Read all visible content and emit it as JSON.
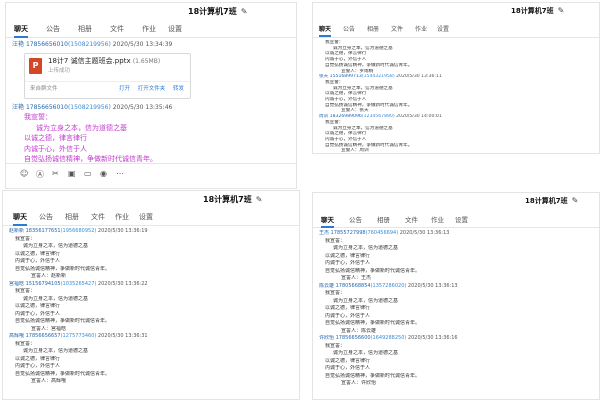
{
  "panel1": {
    "title": "18计算机7班",
    "tabs": [
      "聊天",
      "公告",
      "相册",
      "文件",
      "作业",
      "设置"
    ],
    "msg1_header": {
      "name": "汪艳",
      "id": "17856656010",
      "qq": "(1508219956)",
      "time": "2020/5/30 13:34:39"
    },
    "file": {
      "name": "18计7 诚信主题班会.pptx",
      "size": "(1.65MB)",
      "status": "上传成功",
      "source": "来自群文件",
      "actions": [
        "打开",
        "打开文件夹",
        "转发"
      ]
    },
    "msg2_header": {
      "name": "汪艳",
      "id": "17856656010",
      "qq": "(1508219956)",
      "time": "2020/5/30 13:35:46"
    },
    "poem": [
      "我宣誓：",
      "诚为立身之本，信为道德之基",
      "以诚之德，律言律行",
      "内诚于心，外信于人",
      "自觉弘扬诚信精神，争做新时代诚信青年。"
    ],
    "toolbar_icons": [
      "emoji-icon",
      "font-icon",
      "scissors-icon",
      "image-icon",
      "folder-icon",
      "mic-icon",
      "more-icon"
    ]
  },
  "panel2": {
    "title": "18计算机7班",
    "tabs": [
      "聊天",
      "公告",
      "相册",
      "文件",
      "作业",
      "设置"
    ],
    "lines": [
      {
        "t": "我宣誓：",
        "c": "ind1"
      },
      {
        "t": "诚为立身之本，信为道德之基",
        "c": "ind2"
      },
      {
        "t": "以诚之德，律言律行",
        "c": "ind1"
      },
      {
        "t": "内诚于心，外信于人",
        "c": "ind1"
      },
      {
        "t": "自觉弘扬诚信精神，争做新时代诚信青年。",
        "c": "ind1"
      },
      {
        "t": "宣誓人：罗雨桐",
        "c": "ind3"
      },
      {
        "h": {
          "name": "张天",
          "id": "15516899713",
          "qq": "(1544321958)",
          "time": "2020/5/30 13:36:11"
        }
      },
      {
        "t": "我宣誓：",
        "c": "ind1"
      },
      {
        "t": "诚为立身之本，信为道德之基",
        "c": "ind2"
      },
      {
        "t": "以诚之德，律言律行",
        "c": "ind1"
      },
      {
        "t": "内诚于心，外信于人",
        "c": "ind1"
      },
      {
        "t": "自觉弘扬诚信精神，争做新时代诚信青年。",
        "c": "ind1"
      },
      {
        "t": "宣誓人：张天",
        "c": "ind3"
      },
      {
        "h": {
          "name": "周训",
          "id": "18326989096",
          "qq": "(1234567890)",
          "time": "2020/5/30 14:00:01"
        }
      },
      {
        "t": "我宣誓：",
        "c": "ind1"
      },
      {
        "t": "诚为立身之本，信为道德之基",
        "c": "ind2"
      },
      {
        "t": "以诚之德，律言律行",
        "c": "ind1"
      },
      {
        "t": "内诚于心，外信于人",
        "c": "ind1"
      },
      {
        "t": "自觉弘扬诚信精神，争做新时代诚信青年。",
        "c": "ind1"
      },
      {
        "t": "宣誓人：周训",
        "c": "ind3"
      }
    ]
  },
  "panel3": {
    "title": "18计算机7班",
    "tabs": [
      "聊天",
      "公告",
      "相册",
      "文件",
      "作业",
      "设置"
    ],
    "lines": [
      {
        "h": {
          "name": "赵新新",
          "id": "18356177651",
          "qq": "(1956680952)",
          "time": "2020/5/30 13:36:19"
        }
      },
      {
        "t": "我宣誓：",
        "c": "ind1"
      },
      {
        "t": "诚为立身之本，信为道德之基",
        "c": "ind2"
      },
      {
        "t": "以诚之德，律言律行",
        "c": "ind1"
      },
      {
        "t": "内诚于心，外信于人",
        "c": "ind1"
      },
      {
        "t": "自觉弘扬诚信精神，争做新时代诚信青年。",
        "c": "ind1"
      },
      {
        "t": "宣誓人：赵新新",
        "c": "ind3"
      },
      {
        "h": {
          "name": "宫福晗",
          "id": "15156794105",
          "qq": "(1035265427)",
          "time": "2020/5/30 13:36:22"
        }
      },
      {
        "t": "我宣誓：",
        "c": "ind1"
      },
      {
        "t": "诚为立身之本，信为道德之基",
        "c": "ind2"
      },
      {
        "t": "以诚之德，律言律行",
        "c": "ind1"
      },
      {
        "t": "内诚于心，外信于人",
        "c": "ind1"
      },
      {
        "t": "自觉弘扬诚信精神，争做新时代诚信青年。",
        "c": "ind1"
      },
      {
        "t": "宣誓人：宫福晗",
        "c": "ind3"
      },
      {
        "h": {
          "name": "高辉哦",
          "id": "17856656657",
          "qq": "(1275773460)",
          "time": "2020/5/30 13:36:31"
        }
      },
      {
        "t": "我宣誓：",
        "c": "ind1"
      },
      {
        "t": "诚为立身之本，信为道德之基",
        "c": "ind2"
      },
      {
        "t": "以诚之德，律言律行",
        "c": "ind1"
      },
      {
        "t": "内诚于心，外信于人",
        "c": "ind1"
      },
      {
        "t": "自觉弘扬诚信精神，争做新时代诚信青年。",
        "c": "ind1"
      },
      {
        "t": "宣誓人：高辉哦",
        "c": "ind3"
      }
    ]
  },
  "panel4": {
    "title": "18计算机7班",
    "tabs": [
      "聊天",
      "公告",
      "相册",
      "文件",
      "作业",
      "设置"
    ],
    "lines": [
      {
        "h": {
          "name": "王杰",
          "id": "17855727998",
          "qq": "(760456694)",
          "time": "2020/5/30 13:36:13"
        }
      },
      {
        "t": "我宣誓：",
        "c": "ind1"
      },
      {
        "t": "诚为立身之本，信为道德之基",
        "c": "ind2"
      },
      {
        "t": "以诚之德，律言律行",
        "c": "ind1"
      },
      {
        "t": "内诚于心，外信于人",
        "c": "ind1"
      },
      {
        "t": "自觉弘扬诚信精神，争做新时代诚信青年。",
        "c": "ind1"
      },
      {
        "t": "宣誓人：王杰",
        "c": "ind3"
      },
      {
        "h": {
          "name": "陈云雄",
          "id": "17805668854",
          "qq": "(1357286020)",
          "time": "2020/5/30 13:36:13"
        }
      },
      {
        "t": "我宣誓：",
        "c": "ind1"
      },
      {
        "t": "诚为立身之本，信为道德之基",
        "c": "ind2"
      },
      {
        "t": "以诚之德，律言律行",
        "c": "ind1"
      },
      {
        "t": "内诚于心，外信于人",
        "c": "ind1"
      },
      {
        "t": "自觉弘扬诚信精神，争做新时代诚信青年。",
        "c": "ind1"
      },
      {
        "t": "宣誓人：陈云雄",
        "c": "ind3"
      },
      {
        "h": {
          "name": "许欣怡",
          "id": "17856656600",
          "qq": "(1649288250)",
          "time": "2020/5/30 13:36:16"
        }
      },
      {
        "t": "我宣誓：",
        "c": "ind1"
      },
      {
        "t": "诚为立身之本，信为道德之基",
        "c": "ind2"
      },
      {
        "t": "以诚之德，律言律行",
        "c": "ind1"
      },
      {
        "t": "内诚于心，外信于人",
        "c": "ind1"
      },
      {
        "t": "自觉弘扬诚信精神，争做新时代诚信青年。",
        "c": "ind1"
      },
      {
        "t": "宣誓人：许欣怡",
        "c": "ind3"
      }
    ]
  }
}
